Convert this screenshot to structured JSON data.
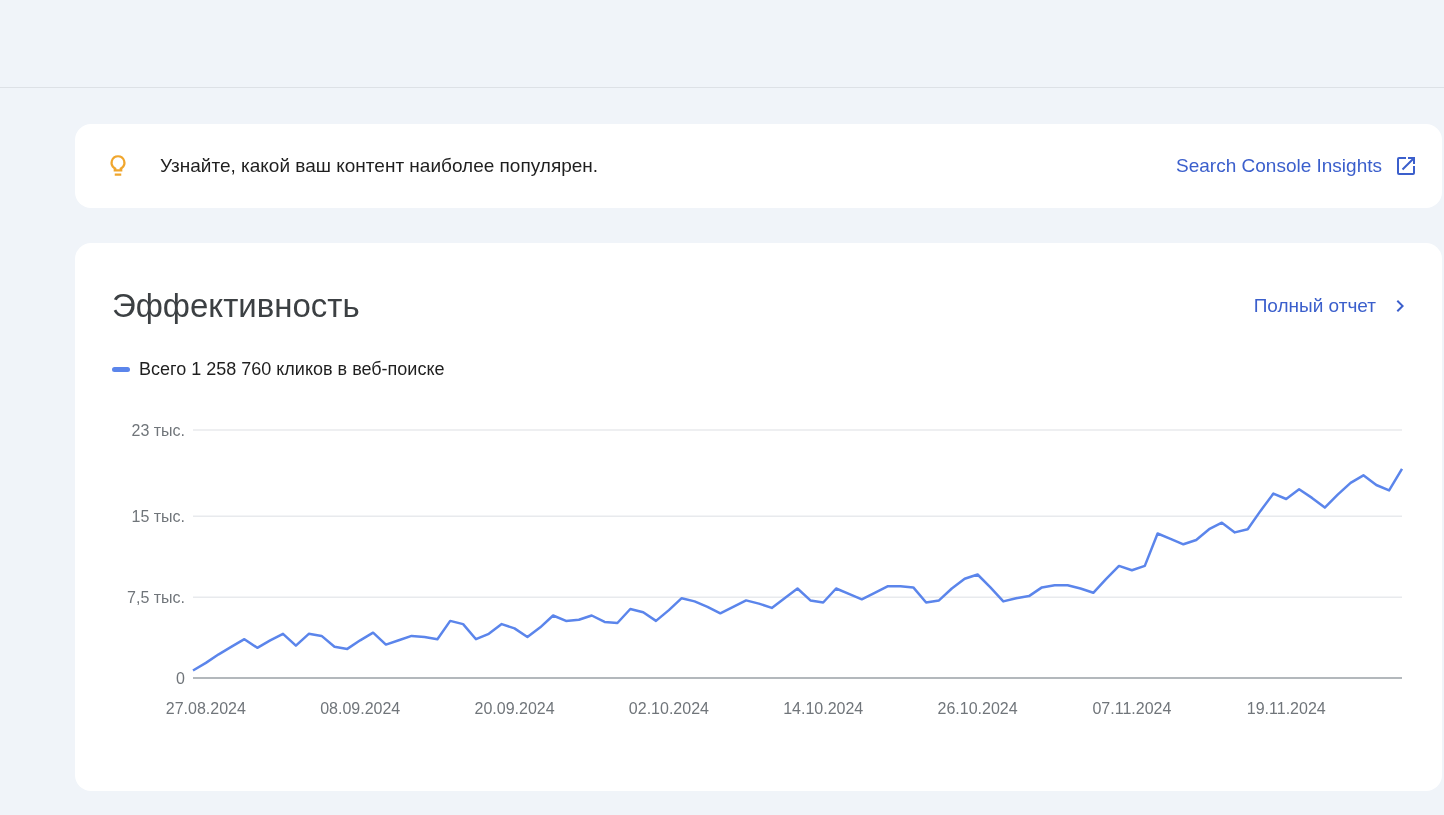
{
  "insight_banner": {
    "text": "Узнайте, какой ваш контент наиболее популярен.",
    "link": "Search Console Insights"
  },
  "performance": {
    "title": "Эффективность",
    "full_report_link": "Полный отчет",
    "chart_data": {
      "type": "line",
      "categories": [
        null,
        "27.08.2024",
        null,
        null,
        null,
        null,
        null,
        null,
        null,
        null,
        null,
        null,
        null,
        "08.09.2024",
        null,
        null,
        null,
        null,
        null,
        null,
        null,
        null,
        null,
        null,
        null,
        "20.09.2024",
        null,
        null,
        null,
        null,
        null,
        null,
        null,
        null,
        null,
        null,
        null,
        "02.10.2024",
        null,
        null,
        null,
        null,
        null,
        null,
        null,
        null,
        null,
        null,
        null,
        "14.10.2024",
        null,
        null,
        null,
        null,
        null,
        null,
        null,
        null,
        null,
        null,
        null,
        "26.10.2024",
        null,
        null,
        null,
        null,
        null,
        null,
        null,
        null,
        null,
        null,
        null,
        "07.11.2024",
        null,
        null,
        null,
        null,
        null,
        null,
        null,
        null,
        null,
        null,
        null,
        "19.11.2024",
        null,
        null,
        null,
        null,
        null,
        null,
        null,
        null,
        null
      ],
      "series": [
        {
          "name": "Всего 1 258 760 кликов в веб-поиске",
          "color": "#5b85eb",
          "values": [
            0.7,
            1.4,
            2.2,
            2.9,
            3.6,
            2.8,
            3.5,
            4.1,
            3.0,
            4.1,
            3.9,
            2.9,
            2.7,
            3.5,
            4.2,
            3.1,
            3.5,
            3.9,
            3.8,
            3.6,
            5.3,
            5.0,
            3.6,
            4.1,
            5.0,
            4.6,
            3.8,
            4.7,
            5.8,
            5.3,
            5.4,
            5.8,
            5.2,
            5.1,
            6.4,
            6.1,
            5.3,
            6.3,
            7.4,
            7.1,
            6.6,
            6.0,
            6.6,
            7.2,
            6.9,
            6.5,
            7.4,
            8.3,
            7.2,
            7.0,
            8.3,
            7.8,
            7.3,
            7.9,
            8.5,
            8.5,
            8.4,
            7.0,
            7.2,
            8.3,
            9.2,
            9.6,
            8.4,
            7.1,
            7.4,
            7.6,
            8.4,
            8.6,
            8.6,
            8.3,
            7.9,
            9.2,
            10.4,
            10.0,
            10.4,
            13.4,
            12.9,
            12.4,
            12.8,
            13.8,
            14.4,
            13.5,
            13.8,
            15.5,
            17.1,
            16.6,
            17.5,
            16.7,
            15.8,
            17.0,
            18.1,
            18.8,
            17.9,
            17.4,
            19.4
          ]
        }
      ],
      "ylim": [
        0,
        23
      ],
      "yticks": [
        0,
        {
          "value": 7.5,
          "label": "7,5 тыс."
        },
        {
          "value": 15,
          "label": "15 тыс."
        },
        {
          "value": 23,
          "label": "23 тыс."
        }
      ]
    }
  }
}
